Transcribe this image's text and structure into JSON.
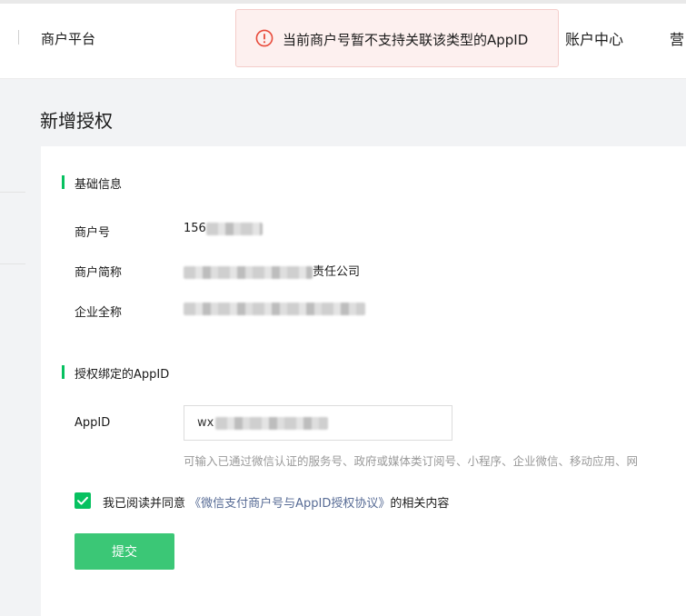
{
  "header": {
    "brand": "商户平台",
    "nav": [
      "账户中心",
      "营"
    ]
  },
  "toast": {
    "message": "当前商户号暂不支持关联该类型的AppID"
  },
  "page": {
    "title": "新增授权"
  },
  "basic_info": {
    "title": "基础信息",
    "merchant_id_label": "商户号",
    "merchant_id_prefix": "156",
    "short_name_label": "商户简称",
    "short_name_suffix": "责任公司",
    "full_name_label": "企业全称"
  },
  "appid_section": {
    "title": "授权绑定的AppID",
    "appid_label": "AppID",
    "appid_prefix": "wx",
    "hint": "可输入已通过微信认证的服务号、政府或媒体类订阅号、小程序、企业微信、移动应用、网"
  },
  "agreement": {
    "checked": true,
    "prefix": "我已阅读并同意",
    "link": "《微信支付商户号与AppID授权协议》",
    "suffix": "的相关内容"
  },
  "submit": {
    "label": "提交"
  },
  "colors": {
    "accent": "#07c160",
    "submit": "#3bc776",
    "link": "#576b95",
    "error": "#e84a3a",
    "toast_bg": "#fdf0ef"
  }
}
